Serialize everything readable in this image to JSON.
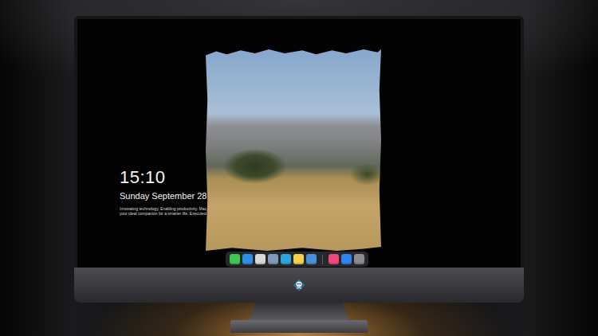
{
  "lock_screen": {
    "time": "15:10",
    "date": "Sunday September 28",
    "tagline": [
      "Innovating technology, Enabling productivity. Mac,",
      "your ideal companion for a smarter life. Executed"
    ]
  },
  "dock": {
    "apps": [
      {
        "color": "#3fc84f"
      },
      {
        "color": "#2f8fe8"
      },
      {
        "color": "#d9d9d9"
      },
      {
        "color": "#7f9ab8"
      },
      {
        "color": "#2aa7d8"
      },
      {
        "color": "#f2d24a"
      },
      {
        "color": "#4a8fd9"
      }
    ],
    "recent": [
      {
        "color": "#f0487a"
      },
      {
        "color": "#2f86f0"
      },
      {
        "color": "#8c8c90"
      }
    ]
  }
}
